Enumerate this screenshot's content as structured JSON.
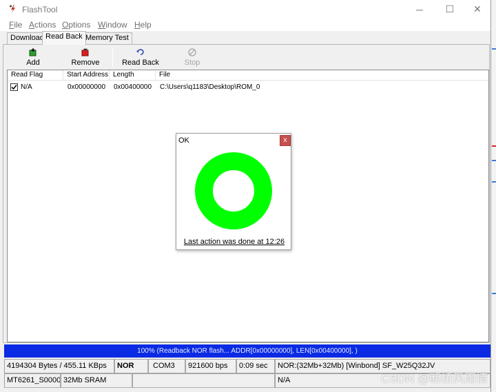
{
  "window": {
    "title": "FlashTool",
    "controls": {
      "minimize": "─",
      "maximize": "☐",
      "close": "✕"
    }
  },
  "menu": [
    {
      "label": "File",
      "accel": "F",
      "rest": "ile"
    },
    {
      "label": "Actions",
      "accel": "A",
      "rest": "ctions"
    },
    {
      "label": "Options",
      "accel": "O",
      "rest": "ptions"
    },
    {
      "label": "Window",
      "accel": "W",
      "rest": "indow"
    },
    {
      "label": "Help",
      "accel": "H",
      "rest": "elp"
    }
  ],
  "tabs": [
    {
      "label": "Download",
      "active": false
    },
    {
      "label": "Read Back",
      "active": true
    },
    {
      "label": "Memory Test",
      "active": false
    }
  ],
  "toolbar": {
    "add": {
      "label": "Add",
      "icon": "add-icon"
    },
    "remove": {
      "label": "Remove",
      "icon": "remove-icon"
    },
    "read_back": {
      "label": "Read Back",
      "icon": "read-back-icon"
    },
    "stop": {
      "label": "Stop",
      "icon": "stop-icon",
      "enabled": false
    }
  },
  "table": {
    "columns": [
      "Read Flag",
      "Start Address",
      "Length",
      "File"
    ],
    "rows": [
      {
        "checked": true,
        "flag": "N/A",
        "start_address": "0x00000000",
        "length": "0x00400000",
        "file": "C:\\Users\\q1183\\Desktop\\ROM_0"
      }
    ]
  },
  "dialog": {
    "title": "OK",
    "close_label": "x",
    "message": "Last action was done at 12:26",
    "ring_color": "#00ff00"
  },
  "progress": {
    "percent": 100,
    "text": "100% (Readback NOR flash... ADDR[0x00000000], LEN[0x00400000], )",
    "color": "#0a2be3"
  },
  "status": {
    "row1": [
      {
        "text": "4194304 Bytes / 455.11 KBps",
        "bold": false
      },
      {
        "text": "NOR",
        "bold": true
      },
      {
        "text": "COM3",
        "bold": false
      },
      {
        "text": "921600 bps",
        "bold": false
      },
      {
        "text": "0:09 sec",
        "bold": false
      },
      {
        "text": "NOR:(32Mb+32Mb) [Winbond] SF_W25Q32JV",
        "bold": false
      }
    ],
    "row2": [
      {
        "text": "MT6261_S0000",
        "bold": false
      },
      {
        "text": "32Mb SRAM",
        "bold": false
      },
      {
        "text": "",
        "bold": false
      },
      {
        "text": "N/A",
        "bold": false
      }
    ]
  },
  "watermark": "CSDN @断桥风雨情"
}
